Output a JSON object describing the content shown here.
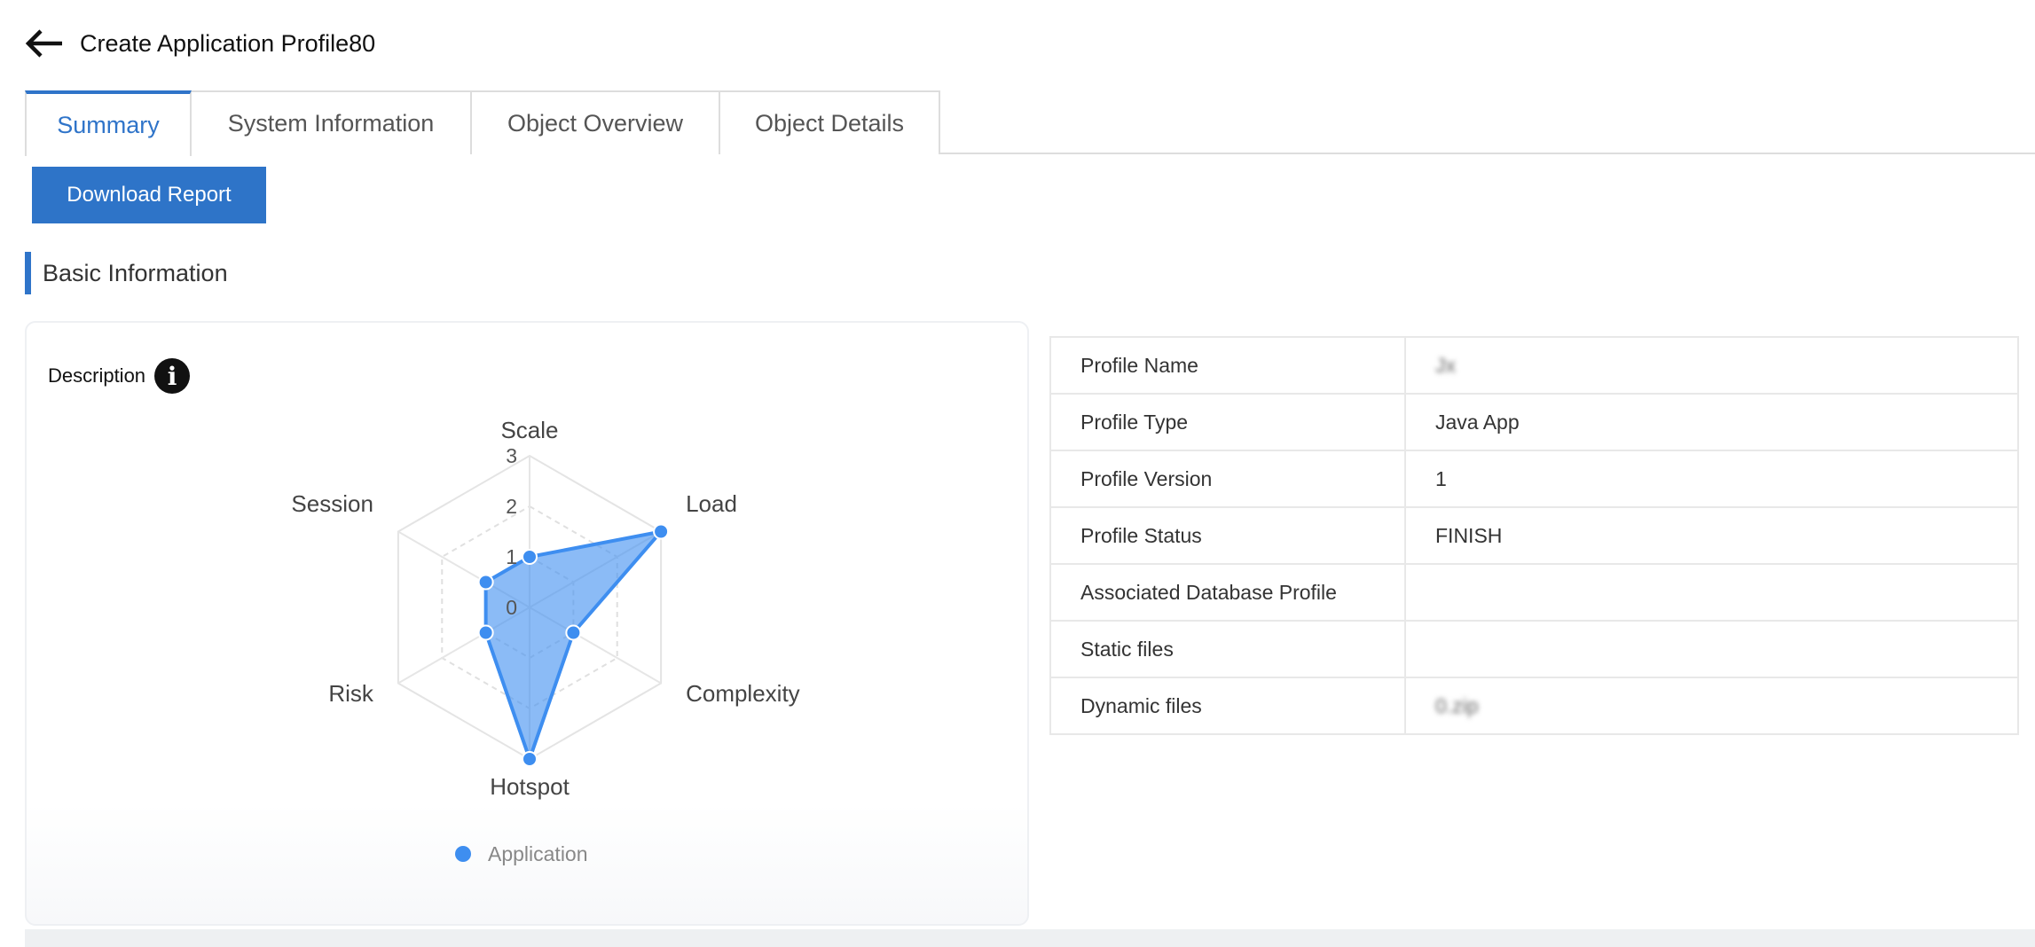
{
  "header": {
    "title": "Create Application Profile80"
  },
  "tabs": [
    {
      "label": "Summary"
    },
    {
      "label": "System Information"
    },
    {
      "label": "Object Overview"
    },
    {
      "label": "Object Details"
    }
  ],
  "toolbar": {
    "download_label": "Download Report"
  },
  "section": {
    "title": "Basic Information"
  },
  "card": {
    "description_label": "Description"
  },
  "chart_data": {
    "type": "radar",
    "axes": [
      "Scale",
      "Load",
      "Complexity",
      "Hotspot",
      "Risk",
      "Session"
    ],
    "ticks": [
      "0",
      "1",
      "2",
      "3"
    ],
    "range": [
      0,
      3
    ],
    "series": [
      {
        "name": "Application",
        "values": [
          1,
          3,
          1,
          3,
          1,
          1
        ]
      }
    ],
    "legend": "bottom",
    "color": "#3e8ef0"
  },
  "info_table": [
    {
      "key": "Profile Name",
      "value": "Jx"
    },
    {
      "key": "Profile Type",
      "value": "Java App"
    },
    {
      "key": "Profile Version",
      "value": "1"
    },
    {
      "key": "Profile Status",
      "value": "FINISH"
    },
    {
      "key": "Associated Database Profile",
      "value": ""
    },
    {
      "key": "Static files",
      "value": ""
    },
    {
      "key": "Dynamic files",
      "value": "0.zip"
    }
  ]
}
